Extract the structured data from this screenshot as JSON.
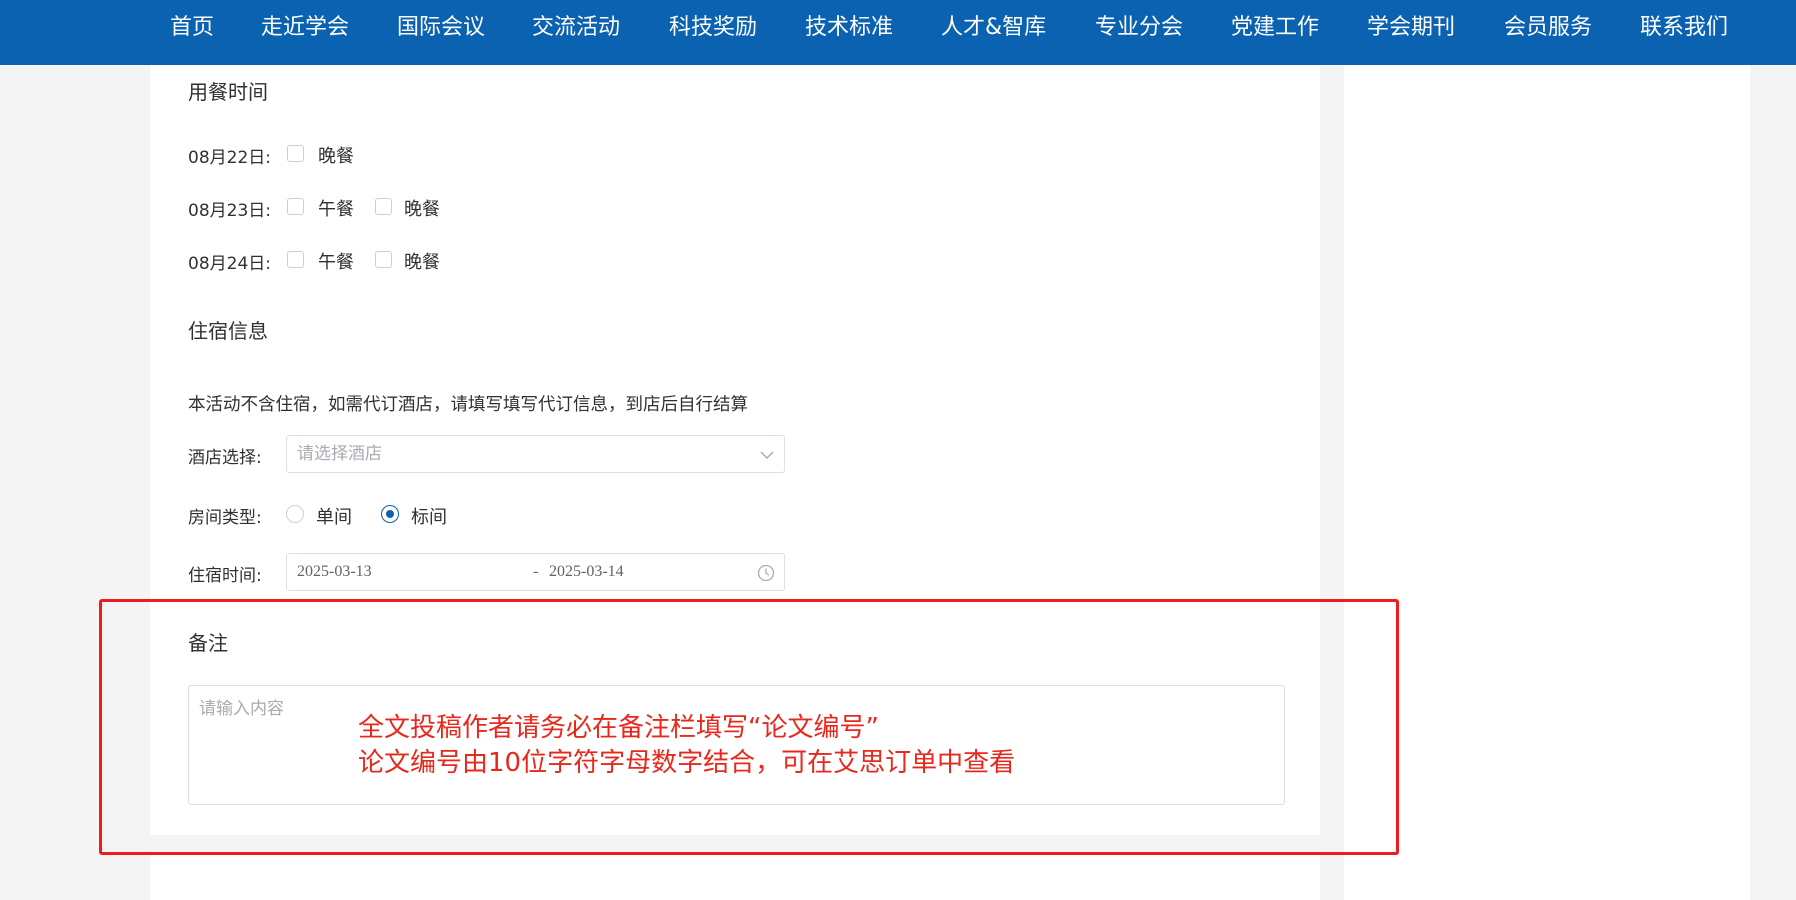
{
  "nav": {
    "items": [
      "首页",
      "走近学会",
      "国际会议",
      "交流活动",
      "科技奖励",
      "技术标准",
      "人才&智库",
      "专业分会",
      "党建工作",
      "学会期刊",
      "会员服务",
      "联系我们"
    ]
  },
  "meals": {
    "title": "用餐时间",
    "rows": [
      {
        "date": "08月22日:",
        "options": [
          "晚餐"
        ]
      },
      {
        "date": "08月23日:",
        "options": [
          "午餐",
          "晚餐"
        ]
      },
      {
        "date": "08月24日:",
        "options": [
          "午餐",
          "晚餐"
        ]
      }
    ]
  },
  "lodging": {
    "title": "住宿信息",
    "notice": "本活动不含住宿，如需代订酒店，请填写填写代订信息，到店后自行结算",
    "hotel_label": "酒店选择:",
    "hotel_placeholder": "请选择酒店",
    "room_label": "房间类型:",
    "room_options": [
      "单间",
      "标间"
    ],
    "room_selected": "标间",
    "date_label": "住宿时间:",
    "date_start": "2025-03-13",
    "date_separator": "-",
    "date_end": "2025-03-14"
  },
  "remarks": {
    "title": "备注",
    "placeholder": "请输入内容"
  },
  "annotation": {
    "line1": "全文投稿作者请务必在备注栏填写“论文编号”",
    "line2": "论文编号由10位字符字母数字结合，可在艾思订单中查看",
    "color": "#e8281c"
  },
  "colors": {
    "nav_bg": "#0b62b0",
    "accent": "#0b62b0",
    "highlight_frame": "#ee1c1c"
  }
}
